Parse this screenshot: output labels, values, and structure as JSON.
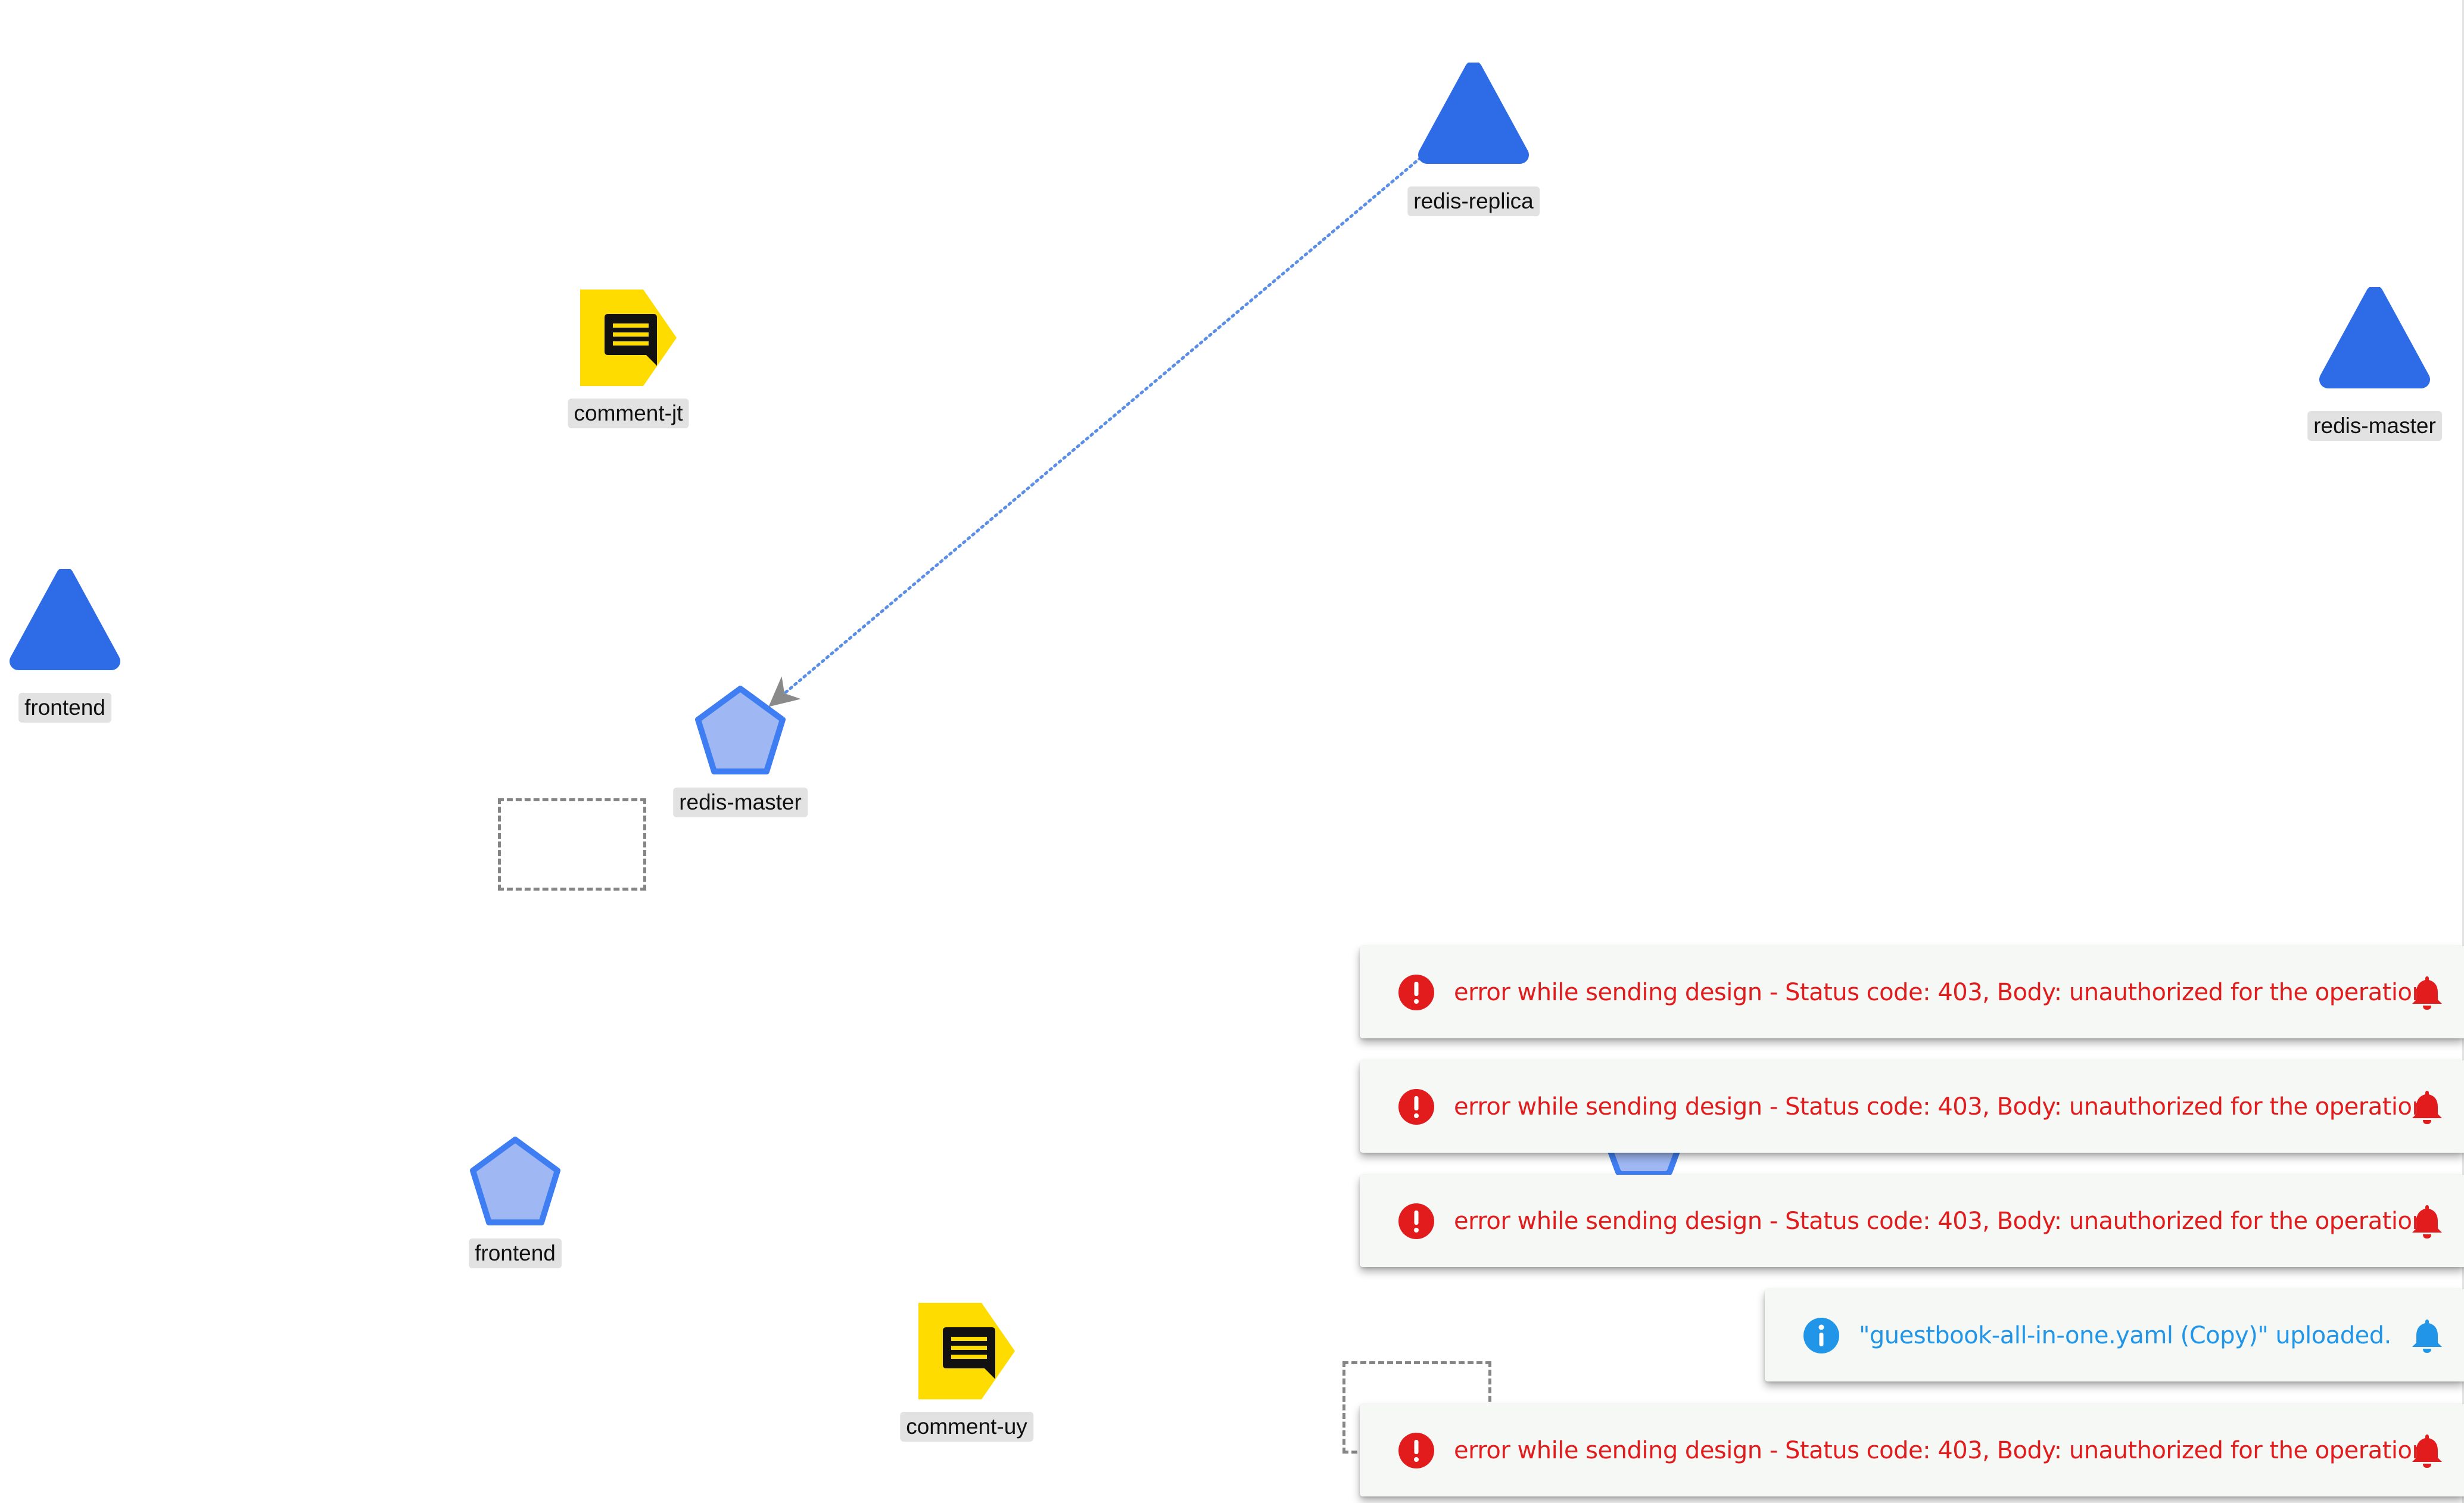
{
  "colors": {
    "service_blue": "#2e6be6",
    "pod_fill": "#9fb8f4",
    "pod_stroke": "#3f7ef2",
    "comment_yellow": "#fedc00",
    "edge_blue": "#5b8ee6",
    "error_red": "#e21c1c",
    "info_blue": "#2196e8"
  },
  "nodes": [
    {
      "id": "redis-replica-service",
      "kind": "service",
      "icon": "triangle-icon",
      "label": "redis-replica"
    },
    {
      "id": "comment-jt",
      "kind": "comment",
      "icon": "comment-icon",
      "label": "comment-jt"
    },
    {
      "id": "redis-master-service",
      "kind": "service",
      "icon": "triangle-icon",
      "label": "redis-master"
    },
    {
      "id": "frontend-service",
      "kind": "service",
      "icon": "triangle-icon",
      "label": "frontend"
    },
    {
      "id": "redis-master-pod",
      "kind": "pod",
      "icon": "pentagon-icon",
      "label": "redis-master"
    },
    {
      "id": "frontend-pod",
      "kind": "pod",
      "icon": "pentagon-icon",
      "label": "frontend"
    },
    {
      "id": "comment-uy",
      "kind": "comment",
      "icon": "comment-icon",
      "label": "comment-uy"
    }
  ],
  "edges": [
    {
      "from": "redis-replica-service",
      "to": "redis-master-pod",
      "style": "dotted",
      "arrow": true
    }
  ],
  "notifications": [
    {
      "type": "error",
      "icon": "error-circle-icon",
      "message": "error while sending design - Status code: 403, Body: unauthorized for the operation"
    },
    {
      "type": "error",
      "icon": "error-circle-icon",
      "message": "error while sending design - Status code: 403, Body: unauthorized for the operation"
    },
    {
      "type": "error",
      "icon": "error-circle-icon",
      "message": "error while sending design - Status code: 403, Body: unauthorized for the operation"
    },
    {
      "type": "info",
      "icon": "info-circle-icon",
      "message": "\"guestbook-all-in-one.yaml (Copy)\" uploaded."
    },
    {
      "type": "error",
      "icon": "error-circle-icon",
      "message": "error while sending design - Status code: 403, Body: unauthorized for the operation"
    }
  ]
}
